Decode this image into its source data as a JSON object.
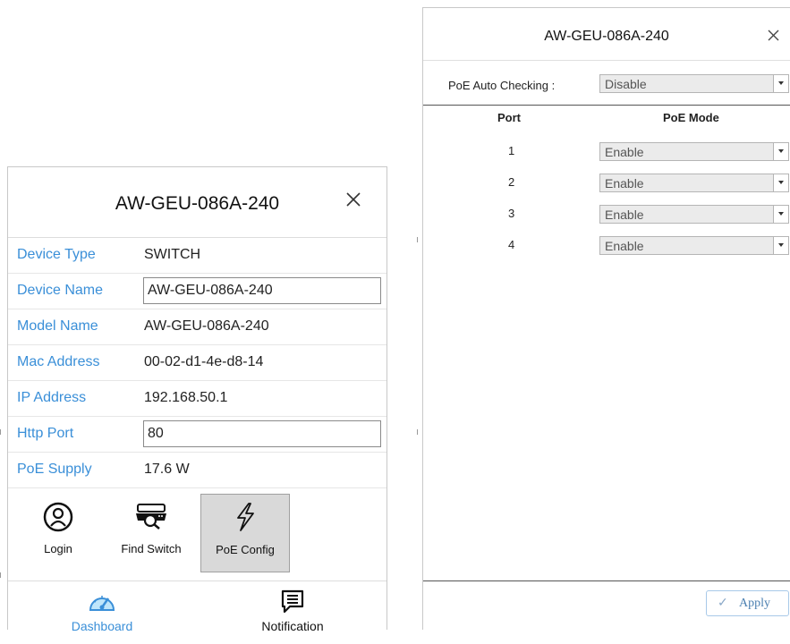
{
  "device_panel": {
    "title": "AW-GEU-086A-240",
    "rows": [
      {
        "label": "Device Type",
        "value": "SWITCH"
      },
      {
        "label": "Device Name",
        "value": "AW-GEU-086A-240"
      },
      {
        "label": "Model Name",
        "value": "AW-GEU-086A-240"
      },
      {
        "label": "Mac Address",
        "value": "00-02-d1-4e-d8-14"
      },
      {
        "label": "IP Address",
        "value": "192.168.50.1"
      },
      {
        "label": "Http Port",
        "value": "80"
      },
      {
        "label": "PoE Supply",
        "value": "17.6 W"
      }
    ],
    "tools": [
      {
        "label": "Login",
        "icon": "user-circle-icon"
      },
      {
        "label": "Find Switch",
        "icon": "find-switch-icon"
      },
      {
        "label": "PoE Config",
        "icon": "lightning-icon",
        "active": true
      }
    ],
    "nav": [
      {
        "label": "Dashboard",
        "icon": "speedometer-icon",
        "active": true
      },
      {
        "label": "Notification",
        "icon": "message-icon"
      }
    ]
  },
  "poe_panel": {
    "title": "AW-GEU-086A-240",
    "auto_checking_label": "PoE Auto Checking :",
    "auto_checking_value": "Disable",
    "columns": [
      "Port",
      "PoE Mode"
    ],
    "ports": [
      {
        "port": "1",
        "mode": "Enable"
      },
      {
        "port": "2",
        "mode": "Enable"
      },
      {
        "port": "3",
        "mode": "Enable"
      },
      {
        "port": "4",
        "mode": "Enable"
      }
    ],
    "apply_label": "Apply"
  },
  "colors": {
    "label_blue": "#3a8fd8",
    "active_tool_bg": "#d9d9d9",
    "apply_text": "#4a7fb0"
  }
}
